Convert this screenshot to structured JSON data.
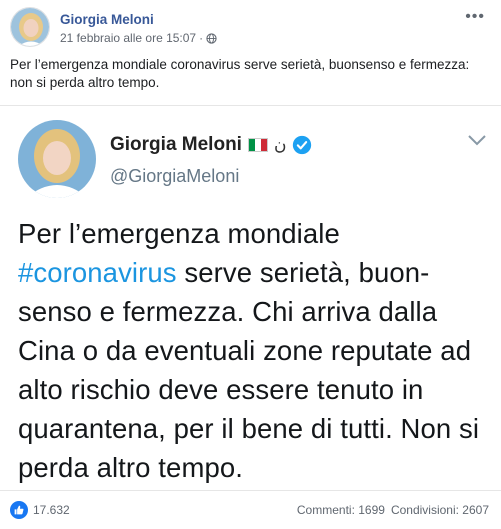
{
  "post": {
    "author": "Giorgia Meloni",
    "timestamp": "21 febbraio alle ore 15:07",
    "separator": "·",
    "privacy_icon": "globe-icon",
    "text": "Per l’emergenza mondiale coronavirus serve serietà, buonsenso e fermezza: non si perda altro tempo."
  },
  "tweet": {
    "name": "Giorgia Meloni",
    "extra_symbol": "ن",
    "handle": "@GiorgiaMeloni",
    "text_before": "Per l’emergenza mondiale ",
    "hashtag": "#coronavirus",
    "text_after": " serve serietà, buon-senso e fermezza. Chi arriva dalla Cina o da eventuali zone reputate ad alto rischio deve essere tenuto in quarantena, per il bene di tutti. Non si perda altro tempo."
  },
  "footer": {
    "likes": "17.632",
    "comments": "Commenti: 1699",
    "shares": "Condivisioni: 2607"
  },
  "colors": {
    "link": "#385898",
    "hashtag": "#1b95e0",
    "like": "#1877f2",
    "verified": "#1da1f2"
  }
}
